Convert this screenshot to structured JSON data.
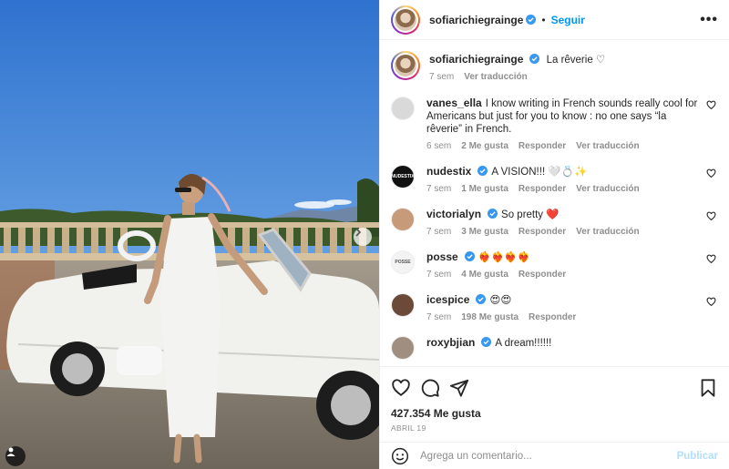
{
  "post": {
    "username": "sofiarichiegrainge",
    "follow_label": "Seguir",
    "dot": "•",
    "more": "•••",
    "caption": {
      "username": "sofiarichiegrainge",
      "text": "La rêverie ♡",
      "time": "7 sem",
      "translate": "Ver traducción"
    },
    "likes": "427.354 Me gusta",
    "date": "ABRIL 19",
    "add_comment_placeholder": "Agrega un comentario...",
    "publish_label": "Publicar"
  },
  "comments": [
    {
      "username": "vanes_ella",
      "verified": false,
      "text": "I know writing in French sounds really cool for Americans but just for you to know : no one says “la rêverie” in French.",
      "time": "6 sem",
      "likes": "2 Me gusta",
      "reply": "Responder",
      "translate": "Ver traducción",
      "avatar_color": "#d9d9d9"
    },
    {
      "username": "nudestix",
      "verified": true,
      "text": "A VISION!!! 🤍💍✨",
      "time": "7 sem",
      "likes": "1 Me gusta",
      "reply": "Responder",
      "translate": "Ver traducción",
      "avatar_color": "#111111"
    },
    {
      "username": "victorialyn",
      "verified": true,
      "text": "So pretty ❤️",
      "time": "7 sem",
      "likes": "3 Me gusta",
      "reply": "Responder",
      "translate": "Ver traducción",
      "avatar_color": "#c79a7a"
    },
    {
      "username": "posse",
      "verified": true,
      "text": "❤️‍🔥❤️‍🔥❤️‍🔥❤️‍🔥",
      "time": "7 sem",
      "likes": "4 Me gusta",
      "reply": "Responder",
      "translate": "",
      "avatar_color": "#f3f3f3"
    },
    {
      "username": "icespice",
      "verified": true,
      "text": "😍😍",
      "time": "7 sem",
      "likes": "198 Me gusta",
      "reply": "Responder",
      "translate": "",
      "avatar_color": "#6b4a3a"
    },
    {
      "username": "roxybjian",
      "verified": true,
      "text": "A dream!!!!!!",
      "time": "",
      "likes": "",
      "reply": "",
      "translate": "",
      "avatar_color": "#a08f80"
    }
  ],
  "avatar_text": {
    "nudestix": "NUDESTIX",
    "posse": "POSSE"
  },
  "icons": {
    "like": "heart-icon",
    "comment": "comment-icon",
    "share": "share-icon",
    "save": "bookmark-icon",
    "emoji": "emoji-icon",
    "next": "chevron-right-icon",
    "tag": "user-tag-icon"
  },
  "colors": {
    "accent": "#0095f6",
    "verified": "#3897f0",
    "muted": "#8e8e8e"
  }
}
